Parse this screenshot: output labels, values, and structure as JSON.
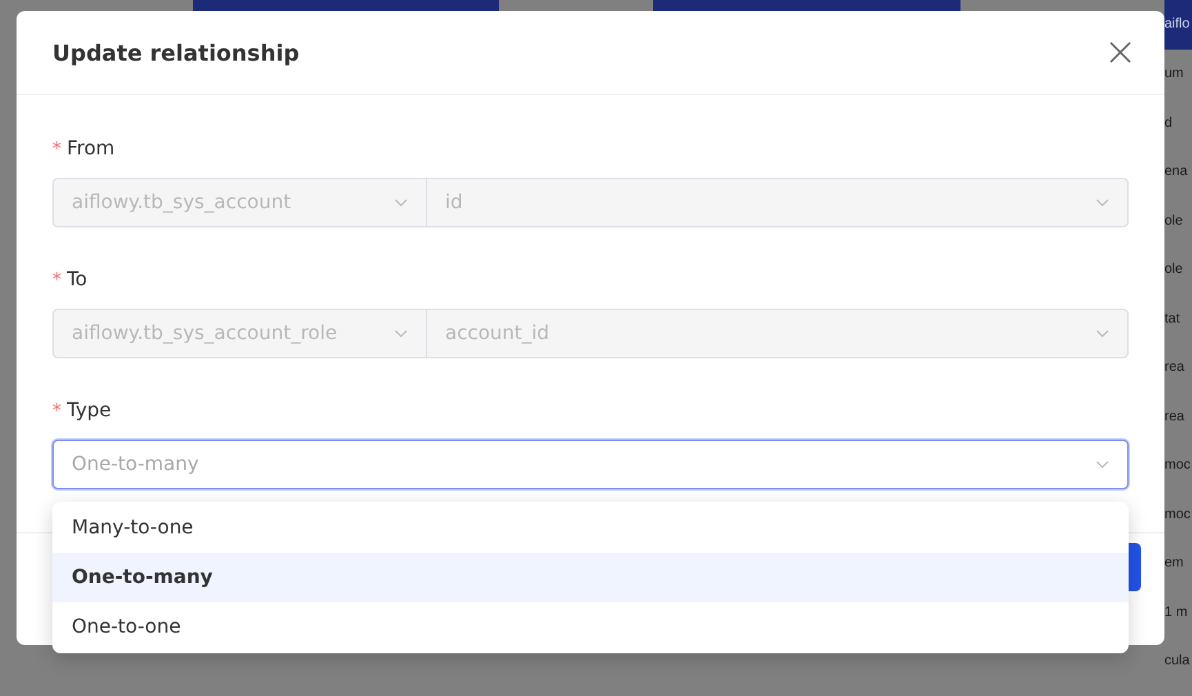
{
  "background": {
    "side_column": {
      "header": "aiflo",
      "rows": [
        "um",
        "d",
        "ena",
        "ole",
        "ole",
        "tat",
        "rea",
        "rea",
        "moc",
        "moc",
        "em",
        "1 m",
        "cula"
      ]
    }
  },
  "dialog": {
    "title": "Update relationship",
    "fields": [
      {
        "label": "From",
        "required_mark": "*",
        "kind": "pair",
        "table": "aiflowy.tb_sys_account",
        "column": "id",
        "disabled": true
      },
      {
        "label": "To",
        "required_mark": "*",
        "kind": "pair",
        "table": "aiflowy.tb_sys_account_role",
        "column": "account_id",
        "disabled": true
      },
      {
        "label": "Type",
        "required_mark": "*",
        "kind": "select",
        "value": "One-to-many",
        "open": true,
        "options": [
          {
            "label": "Many-to-one",
            "selected": false
          },
          {
            "label": "One-to-many",
            "selected": true
          },
          {
            "label": "One-to-one",
            "selected": false
          }
        ]
      }
    ]
  }
}
